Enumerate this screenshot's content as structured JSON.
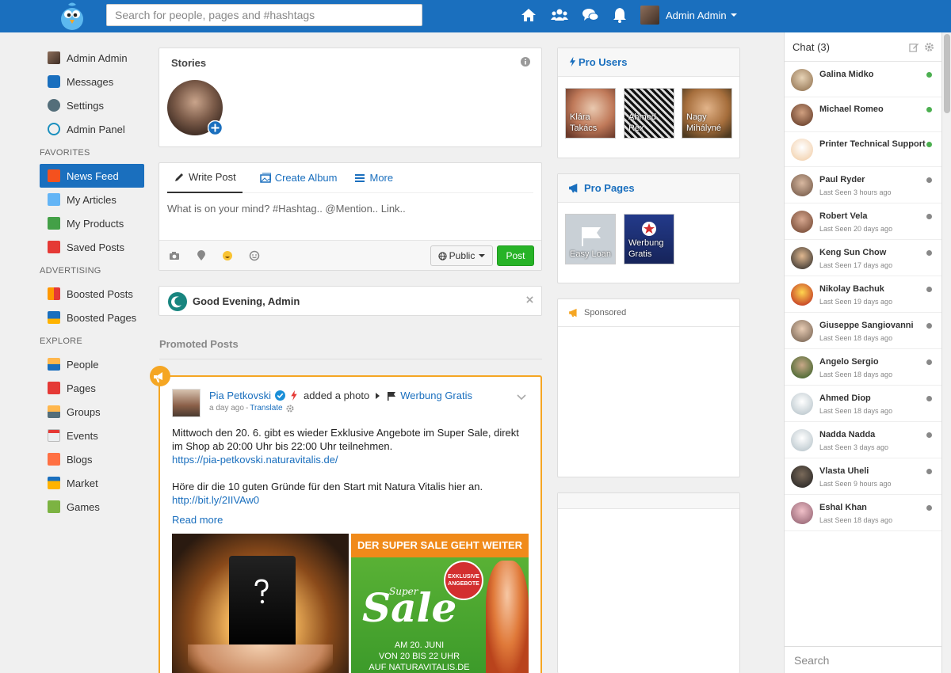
{
  "header": {
    "search_placeholder": "Search for people, pages and #hashtags",
    "user_name": "Admin Admin",
    "accent": "#1a6fbe"
  },
  "leftnav": {
    "profile": "Admin Admin",
    "items_top": [
      "Messages",
      "Settings",
      "Admin Panel"
    ],
    "favorites_label": "FAVORITES",
    "favorites": [
      "News Feed",
      "My Articles",
      "My Products",
      "Saved Posts"
    ],
    "advertising_label": "ADVERTISING",
    "advertising": [
      "Boosted Posts",
      "Boosted Pages"
    ],
    "explore_label": "EXPLORE",
    "explore": [
      "People",
      "Pages",
      "Groups",
      "Events",
      "Blogs",
      "Market",
      "Games"
    ]
  },
  "stories": {
    "title": "Stories"
  },
  "composer": {
    "tab_write": "Write Post",
    "tab_album": "Create Album",
    "tab_more": "More",
    "placeholder": "What is on your mind? #Hashtag.. @Mention.. Link..",
    "privacy": "Public",
    "post_button": "Post"
  },
  "greeting": {
    "text": "Good Evening, Admin"
  },
  "promoted": {
    "label": "Promoted Posts"
  },
  "post": {
    "author": "Pia Petkovski",
    "action": "added a photo",
    "target_page": "Werbung Gratis",
    "time": "a day ago",
    "translate": "Translate",
    "text1": "Mittwoch den 20. 6. gibt es wieder Exklusive Angebote im Super Sale, direkt im Shop ab 20:00 Uhr bis 22:00 Uhr teilnehmen.",
    "link1": "https://pia-petkovski.naturavitalis.de/",
    "text2": "Höre dir die 10 guten Gründe für den Start mit Natura Vitalis hier an.",
    "link2": "http://bit.ly/2IIVAw0",
    "read_more": "Read more",
    "img2_banner": "DER SUPER SALE GEHT WEITER",
    "img2_badge": "EXKLUSIVE ANGEBOTE",
    "img2_sale1": "Super",
    "img2_sale2": "Sale",
    "img2_line1": "AM 20. JUNI",
    "img2_line2": "VON 20 BIS 22 UHR",
    "img2_line3": "AUF NATURAVITALIS.DE"
  },
  "pro_users": {
    "title": "Pro Users",
    "users": [
      "Klára Takács",
      "Ahmed Rex",
      "Nagy Mihályné"
    ]
  },
  "pro_pages": {
    "title": "Pro Pages",
    "pages": [
      "Easy Loan",
      "Werbung Gratis"
    ]
  },
  "sponsored": {
    "title": "Sponsored"
  },
  "chat": {
    "title": "Chat (3)",
    "search_placeholder": "Search",
    "online_color": "#4caf50",
    "offline_color": "#888888",
    "contacts": [
      {
        "name": "Galina Midko",
        "seen": ""
      },
      {
        "name": "Michael Romeo",
        "seen": ""
      },
      {
        "name": "Printer Technical Support",
        "seen": ""
      },
      {
        "name": "Paul Ryder",
        "seen": "Last Seen 3 hours ago"
      },
      {
        "name": "Robert Vela",
        "seen": "Last Seen 20 days ago"
      },
      {
        "name": "Keng Sun Chow",
        "seen": "Last Seen 17 days ago"
      },
      {
        "name": "Nikolay Bachuk",
        "seen": "Last Seen 19 days ago"
      },
      {
        "name": "Giuseppe Sangiovanni",
        "seen": "Last Seen 18 days ago"
      },
      {
        "name": "Angelo Sergio",
        "seen": "Last Seen 18 days ago"
      },
      {
        "name": "Ahmed Diop",
        "seen": "Last Seen 18 days ago"
      },
      {
        "name": "Nadda Nadda",
        "seen": "Last Seen 3 days ago"
      },
      {
        "name": "Vlasta Uheli",
        "seen": "Last Seen 9 hours ago"
      },
      {
        "name": "Eshal Khan",
        "seen": "Last Seen 18 days ago"
      }
    ]
  }
}
